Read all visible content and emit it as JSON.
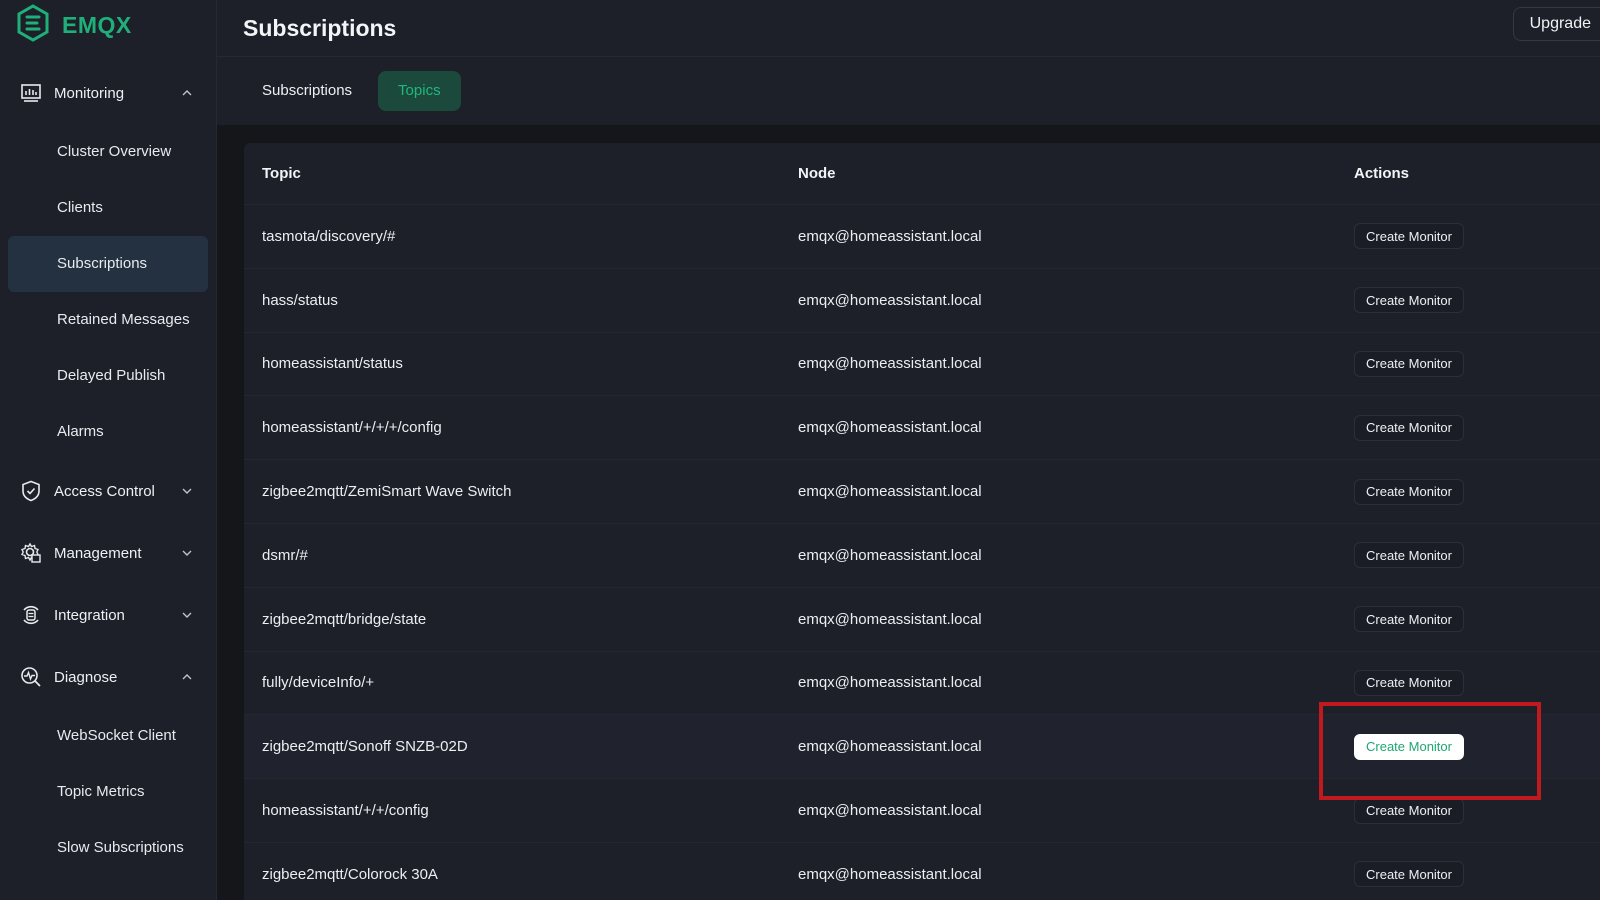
{
  "app": {
    "brand": "EMQX",
    "accent": "#1fb07a",
    "annotation_color": "#c01a1f"
  },
  "sidebar": {
    "groups": [
      {
        "label": "Monitoring",
        "icon": "monitor-chart-icon",
        "expanded": true,
        "items": [
          {
            "label": "Cluster Overview"
          },
          {
            "label": "Clients"
          },
          {
            "label": "Subscriptions",
            "active": true
          },
          {
            "label": "Retained Messages"
          },
          {
            "label": "Delayed Publish"
          },
          {
            "label": "Alarms"
          }
        ]
      },
      {
        "label": "Access Control",
        "icon": "shield-check-icon",
        "expanded": false
      },
      {
        "label": "Management",
        "icon": "gear-icon",
        "expanded": false
      },
      {
        "label": "Integration",
        "icon": "integration-icon",
        "expanded": false
      },
      {
        "label": "Diagnose",
        "icon": "diagnose-search-icon",
        "expanded": true,
        "items": [
          {
            "label": "WebSocket Client"
          },
          {
            "label": "Topic Metrics"
          },
          {
            "label": "Slow Subscriptions"
          }
        ]
      }
    ]
  },
  "header": {
    "title": "Subscriptions",
    "upgrade_label": "Upgrade"
  },
  "tabs": [
    {
      "label": "Subscriptions",
      "active": false
    },
    {
      "label": "Topics",
      "active": true
    }
  ],
  "table": {
    "columns": [
      "Topic",
      "Node",
      "Actions"
    ],
    "action_label": "Create Monitor",
    "rows": [
      {
        "topic": "tasmota/discovery/#",
        "node": "emqx@homeassistant.local"
      },
      {
        "topic": "hass/status",
        "node": "emqx@homeassistant.local"
      },
      {
        "topic": "homeassistant/status",
        "node": "emqx@homeassistant.local"
      },
      {
        "topic": "homeassistant/+/+/+/config",
        "node": "emqx@homeassistant.local"
      },
      {
        "topic": "zigbee2mqtt/ZemiSmart Wave Switch",
        "node": "emqx@homeassistant.local"
      },
      {
        "topic": "dsmr/#",
        "node": "emqx@homeassistant.local"
      },
      {
        "topic": "zigbee2mqtt/bridge/state",
        "node": "emqx@homeassistant.local"
      },
      {
        "topic": "fully/deviceInfo/+",
        "node": "emqx@homeassistant.local"
      },
      {
        "topic": "zigbee2mqtt/Sonoff SNZB-02D",
        "node": "emqx@homeassistant.local",
        "focused": true
      },
      {
        "topic": "homeassistant/+/+/config",
        "node": "emqx@homeassistant.local"
      },
      {
        "topic": "zigbee2mqtt/Colorock 30A",
        "node": "emqx@homeassistant.local"
      }
    ]
  }
}
